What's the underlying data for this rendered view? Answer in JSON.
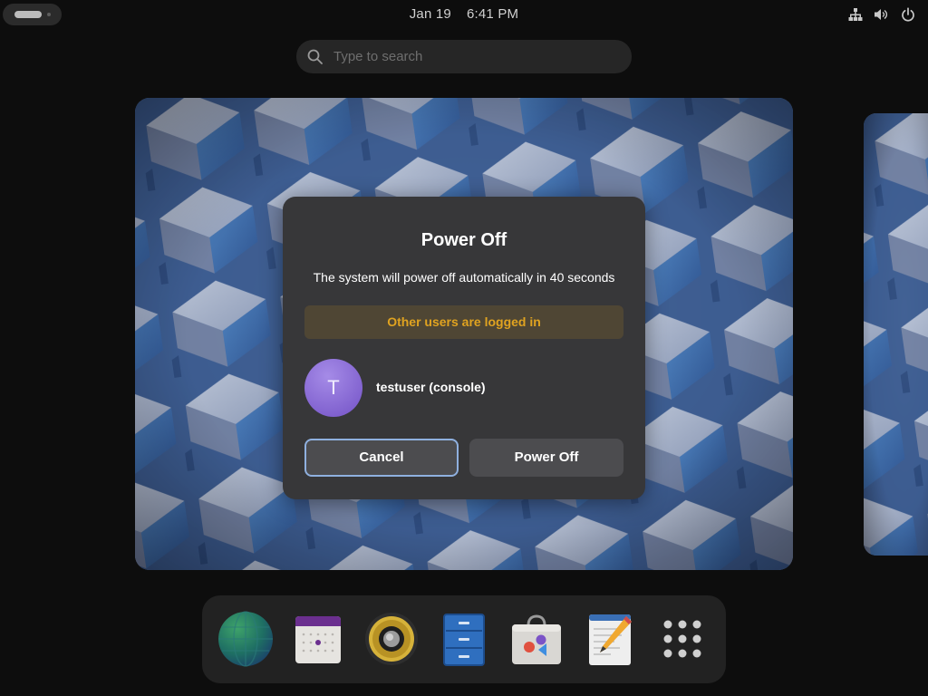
{
  "topbar": {
    "date": "Jan 19",
    "time": "6:41 PM",
    "icons": [
      "activities-indicator",
      "network-wired-icon",
      "volume-icon",
      "power-icon"
    ]
  },
  "search": {
    "placeholder": "Type to search",
    "value": "",
    "icon": "search-icon"
  },
  "dialog": {
    "title": "Power Off",
    "description": "The system will power off automatically in 40 seconds",
    "warning": "Other users are logged in",
    "user": {
      "avatar_initial": "T",
      "name": "testuser (console)"
    },
    "buttons": {
      "cancel": "Cancel",
      "power_off": "Power Off"
    }
  },
  "dash": {
    "apps": [
      "browser-globe-icon",
      "calendar-icon",
      "speaker-icon",
      "file-cabinet-icon",
      "software-store-icon",
      "text-editor-icon",
      "show-apps-grid-icon"
    ]
  },
  "colors": {
    "accent": "#8fb0df",
    "warning_text": "#e0a320",
    "dialog_bg": "#373739",
    "avatar": "#7e5fd1"
  }
}
